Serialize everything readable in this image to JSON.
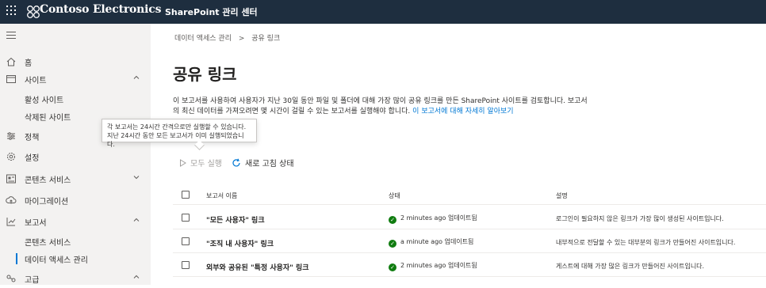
{
  "topbar": {
    "org_name": "Contoso Electronics",
    "app_name": "SharePoint 관리 센터"
  },
  "sidebar": {
    "home": "홈",
    "sites": "사이트",
    "active_sites": "활성 사이트",
    "deleted_sites": "삭제된 사이트",
    "policies": "정책",
    "settings": "설정",
    "content_services": "콘텐츠 서비스",
    "migration": "마이그레이션",
    "reports": "보고서",
    "reports_content_services": "콘텐츠 서비스",
    "data_access_governance": "데이터 액세스 관리",
    "advanced": "고급"
  },
  "breadcrumb": {
    "parent": "데이터 액세스 관리",
    "separator": ">",
    "current": "공유 링크"
  },
  "page": {
    "title": "공유 링크",
    "description": "이 보고서를 사용하여 사용자가 지난 30일 동안 파일 및 폴더에 대해 가장 많이 공유 링크를 만든 SharePoint 사이트를 검토합니다. 보고서의 최신 데이터를 가져오려면 몇 시간이 걸릴 수 있는 보고서를 실행해야 합니다.",
    "learn_more": "이 보고서에 대해 자세히 알아보기"
  },
  "tooltip": {
    "text": "각 보고서는 24시간 간격으로만 실행할 수 있습니다. 지난 24시간 동안 모든 보고서가 이미 실행되었습니다."
  },
  "commands": {
    "run_all": "모두 실행",
    "refresh_status": "새로 고침 상태"
  },
  "table": {
    "headers": {
      "name": "보고서 이름",
      "status": "상태",
      "description": "설명"
    },
    "rows": [
      {
        "name": "\"모든 사용자\" 링크",
        "status": "2 minutes ago 업데이트됨",
        "description": "로그인이 필요하지 않은 링크가 가장 많이 생성된 사이트입니다."
      },
      {
        "name": "\"조직 내 사용자\" 링크",
        "status": "a minute ago 업데이트됨",
        "description": "내부적으로 전달할 수 있는 대부분의 링크가 만들어진 사이트입니다."
      },
      {
        "name": "외부와 공유된 \"특정 사용자\" 링크",
        "status": "2 minutes ago 업데이트됨",
        "description": "게스트에 대해 가장 많은 링크가 만들어진 사이트입니다."
      }
    ]
  },
  "colors": {
    "topbar": "#1e2e3f",
    "accent": "#0078d4",
    "success": "#107c10",
    "sidebar": "#f3f2f1"
  },
  "icons": [
    "waffle-icon",
    "logo-icon",
    "hamburger-icon",
    "home-icon",
    "sites-icon",
    "policies-icon",
    "settings-icon",
    "content-services-icon",
    "migration-icon",
    "reports-icon",
    "advanced-icon",
    "play-icon",
    "refresh-icon",
    "success-icon"
  ]
}
